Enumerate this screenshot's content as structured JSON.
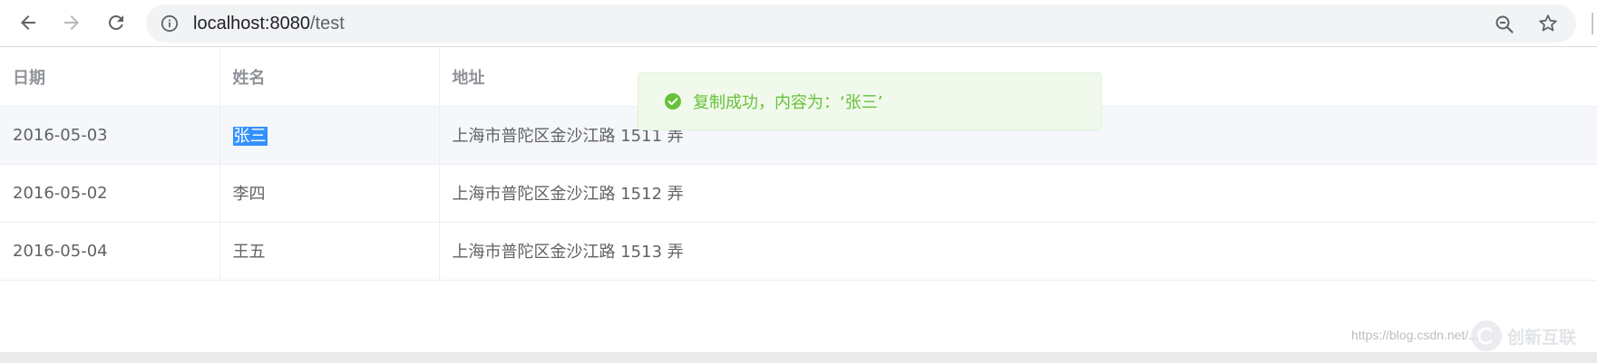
{
  "browser": {
    "url_host": "localhost:8080",
    "url_path": "/test"
  },
  "table": {
    "headers": [
      "日期",
      "姓名",
      "地址"
    ],
    "rows": [
      {
        "date": "2016-05-03",
        "name": "张三",
        "address": "上海市普陀区金沙江路 1511 弄"
      },
      {
        "date": "2016-05-02",
        "name": "李四",
        "address": "上海市普陀区金沙江路 1512 弄"
      },
      {
        "date": "2016-05-04",
        "name": "王五",
        "address": "上海市普陀区金沙江路 1513 弄"
      }
    ]
  },
  "toast": {
    "message": "复制成功，内容为：‘张三’",
    "color": "#67c23a",
    "background": "#f0f9eb"
  },
  "watermark": {
    "url_text": "https://blog.csdn.net/...",
    "logo_text": "创新互联"
  },
  "icons": {
    "back": "arrow-left-icon",
    "forward": "arrow-right-icon",
    "reload": "reload-icon",
    "info": "info-icon",
    "zoom": "zoom-out-icon",
    "bookmark": "star-icon",
    "success": "check-circle-icon"
  }
}
